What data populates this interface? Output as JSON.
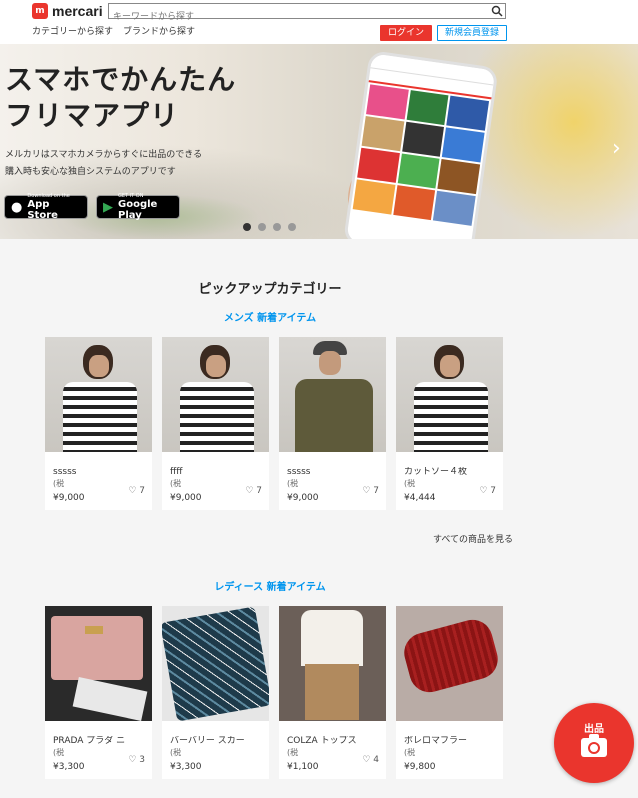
{
  "header": {
    "logo_text": "mercari",
    "search_placeholder": "キーワードから探す",
    "nav": [
      "カテゴリーから探す",
      "ブランドから探す"
    ],
    "login": "ログイン",
    "signup": "新規会員登録"
  },
  "hero": {
    "title": "スマホでかんたん\nフリマアプリ",
    "subtitle": "メルカリはスマホカメラからすぐに出品のできる\n購入時も安心な独自システムのアプリです",
    "appstore_small": "Download on the",
    "appstore_big": "App Store",
    "gplay_small": "GET IT ON",
    "gplay_big": "Google Play",
    "slide_count": 4,
    "active_slide": 1
  },
  "pickup_title": "ピックアップカテゴリー",
  "mens": {
    "title": "メンズ 新着アイテム",
    "items": [
      {
        "name": "sssss",
        "tax": "(税",
        "price": "¥9,000",
        "likes": "7"
      },
      {
        "name": "ffff",
        "tax": "(税",
        "price": "¥9,000",
        "likes": "7"
      },
      {
        "name": "sssss",
        "tax": "(税",
        "price": "¥9,000",
        "likes": "7"
      },
      {
        "name": "カットソー４枚",
        "tax": "(税",
        "price": "¥4,444",
        "likes": "7"
      }
    ],
    "see_all": "すべての商品を見る"
  },
  "ladies": {
    "title": "レディース 新着アイテム",
    "items": [
      {
        "name": "PRADA プラダ ニ",
        "tax": "(税",
        "price": "¥3,300",
        "likes": "3"
      },
      {
        "name": "バーバリー スカー",
        "tax": "(税",
        "price": "¥3,300",
        "likes": ""
      },
      {
        "name": "COLZA トップス",
        "tax": "(税",
        "price": "¥1,100",
        "likes": "4"
      },
      {
        "name": "ボレロマフラー",
        "tax": "(税",
        "price": "¥9,800",
        "likes": ""
      }
    ]
  },
  "sell_button": "出品",
  "colors": {
    "brand_red": "#ea352d",
    "link_blue": "#0095ee"
  }
}
